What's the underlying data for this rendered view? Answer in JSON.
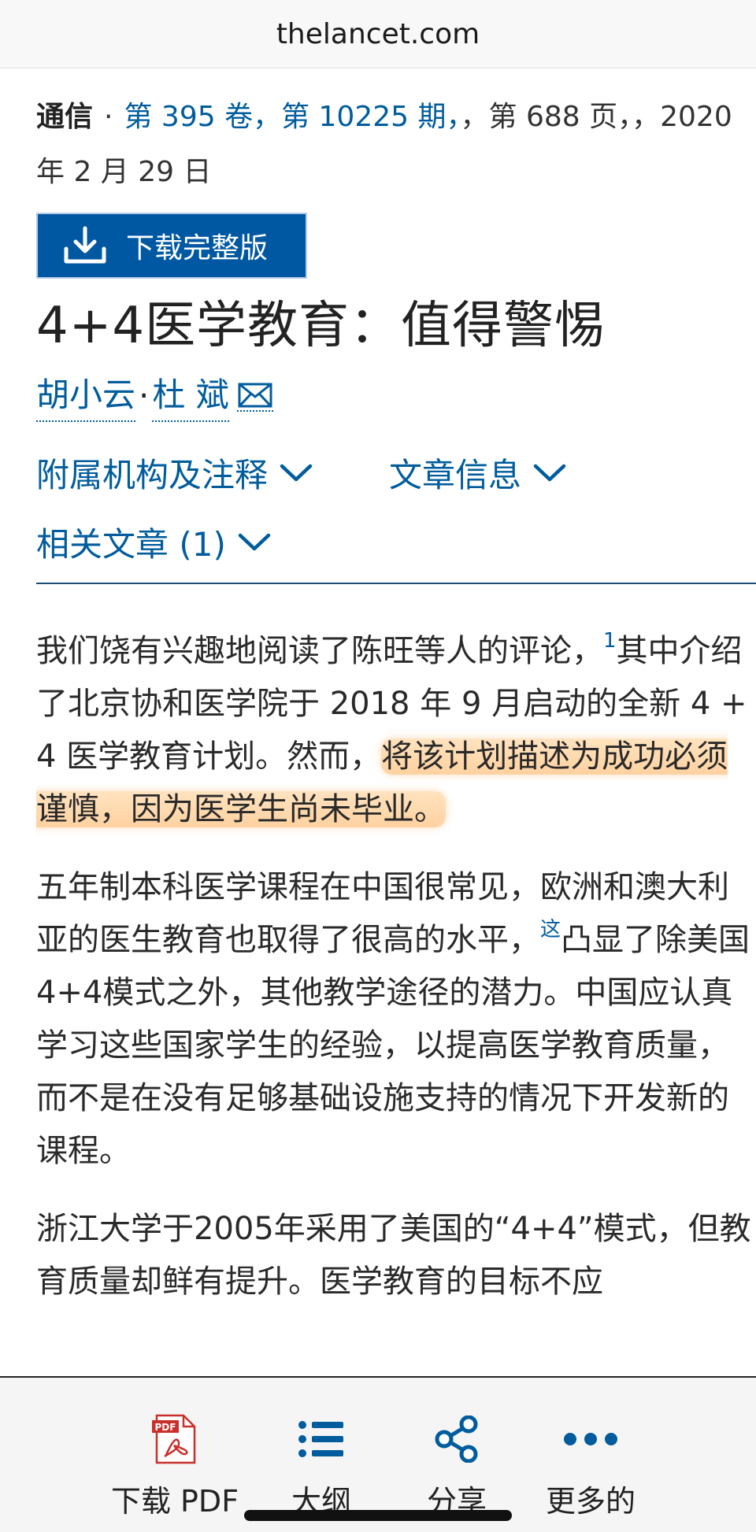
{
  "browser": {
    "url": "thelancet.com"
  },
  "meta": {
    "type": "通信",
    "dot": "·",
    "volume": "第 395 卷，",
    "issue": "第 10225 期，",
    "rest": "，第 688 页，，2020 年 2 月 29 日"
  },
  "download_button": {
    "label": "下载完整版",
    "icon": "download-icon"
  },
  "title": "4+4医学教育：值得警惕",
  "authors": [
    {
      "name": "胡小云"
    },
    {
      "name": "杜 斌"
    }
  ],
  "author_sep": "·",
  "links": {
    "affiliations": "附属机构及注释",
    "article_info": "文章信息",
    "related": "相关文章 (1)"
  },
  "paragraphs": {
    "p1_a": "我们饶有兴趣地阅读了陈旺等人的评论，",
    "p1_sup": "1",
    "p1_b": "其中介绍了北京协和医学院于 2018 年 9 月启动的全新 4 + 4 医学教育计划。然而，",
    "p1_highlight": "将该计划描述为成功必须谨慎，因为医学生尚未毕业。",
    "p2_a": "五年制本科医学课程在中国很常见，欧洲和澳大利亚的医生教育也取得了很高的水平，",
    "p2_sup": "这",
    "p2_b": "凸显了除美国4+4模式之外，其他教学途径的潜力。中国应认真学习这些国家学生的经验，以提高医学教育质量，而不是在没有足够基础设施支持的情况下开发新的课程。",
    "p3": "浙江大学于2005年采用了美国的“4+4”模式，但教育质量却鲜有提升。医学教育的目标不应"
  },
  "toolbar": [
    {
      "label": "下载 PDF",
      "icon": "pdf-icon"
    },
    {
      "label": "大纲",
      "icon": "outline-list-icon"
    },
    {
      "label": "分享",
      "icon": "share-icon"
    },
    {
      "label": "更多的",
      "icon": "more-dots-icon"
    }
  ],
  "colors": {
    "link": "#005c9c",
    "button": "#0058a3",
    "highlight": "#ffc88c"
  }
}
